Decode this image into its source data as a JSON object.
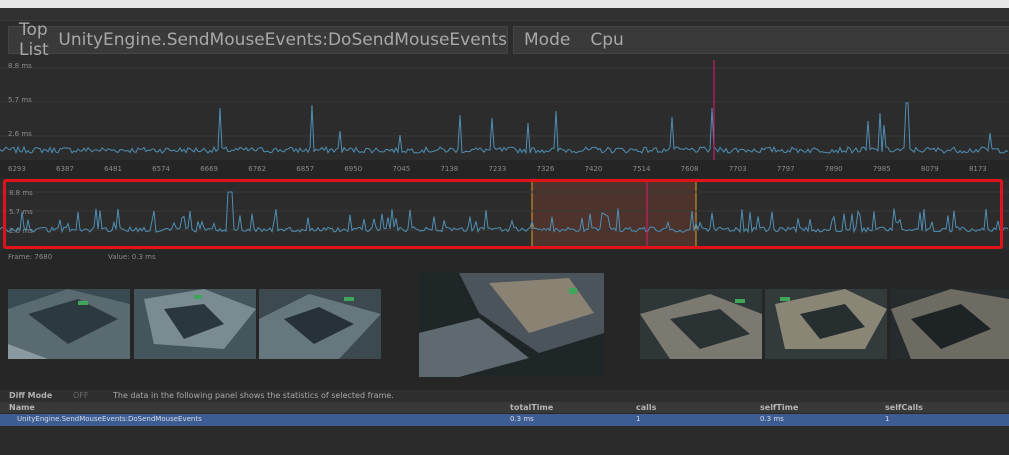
{
  "toolbar": {
    "top_list_label": "Top List",
    "function_name": "UnityEngine.SendMouseEvents:DoSendMouseEvents",
    "mode_label": "Mode",
    "mode_value": "Cpu"
  },
  "graph_top": {
    "y_labels": [
      "8.8 ms",
      "5.7 ms",
      "2.6 ms"
    ],
    "x_ticks": [
      "6293",
      "6387",
      "6481",
      "6574",
      "6669",
      "6762",
      "6857",
      "6950",
      "7045",
      "7138",
      "7233",
      "7326",
      "7420",
      "7514",
      "7608",
      "7703",
      "7797",
      "7890",
      "7985",
      "8079",
      "8173"
    ]
  },
  "graph_overview": {
    "y_labels": [
      "8.8 ms",
      "5.7 ms",
      "2.6 ms"
    ]
  },
  "frame_info": {
    "frame": "Frame: 7680",
    "value": "Value: 0.3 ms"
  },
  "diff_bar": {
    "diff_mode_label": "Diff Mode",
    "toggle": "OFF",
    "description": "The data in the following panel shows the statistics of selected frame."
  },
  "table": {
    "headers": [
      "Name",
      "totalTime",
      "calls",
      "selfTime",
      "selfCalls"
    ],
    "rows": [
      [
        "UnityEngine.SendMouseEvents:DoSendMouseEvents",
        "0.3 ms",
        "1",
        "0.3 ms",
        "1"
      ]
    ]
  },
  "colors": {
    "graph_line": "#4f8fb3",
    "selection_marker": "#e0196e",
    "range_marker": "#e0a030",
    "highlight_box": "#e0131b",
    "selected_row": "#3d5d92"
  }
}
